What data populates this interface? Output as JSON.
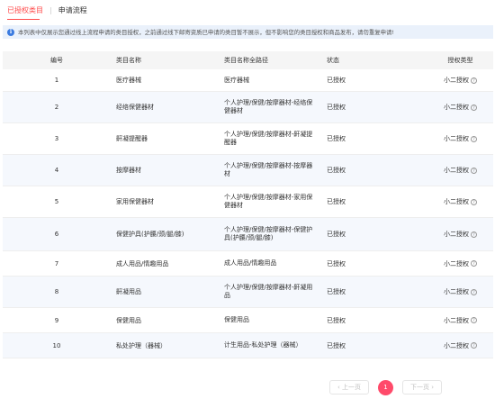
{
  "tabs": {
    "active": "已授权类目",
    "separator": "|",
    "inactive": "申请流程"
  },
  "notice": {
    "icon": "info-icon",
    "text": "本列表中仅展示您通过线上流程申请的类目授权，之前通过线下邮寄资质已申请的类目暂不展示，但不影响您的类目授权和商品发布，请勿重复申请!"
  },
  "table": {
    "headers": {
      "id": "编号",
      "name": "类目名称",
      "path": "类目名称全路径",
      "status": "状态",
      "type": "授权类型"
    },
    "rows": [
      {
        "id": "1",
        "name": "医疗器械",
        "path": "医疗器械",
        "status": "已授权",
        "type": "小二授权"
      },
      {
        "id": "2",
        "name": "经络保健器材",
        "path": "个人护理/保健/按摩器材-经络保健器材",
        "status": "已授权",
        "type": "小二授权"
      },
      {
        "id": "3",
        "name": "鼾凝提醒器",
        "path": "个人护理/保健/按摩器材-鼾凝提醒器",
        "status": "已授权",
        "type": "小二授权"
      },
      {
        "id": "4",
        "name": "按摩器材",
        "path": "个人护理/保健/按摩器材-按摩器材",
        "status": "已授权",
        "type": "小二授权"
      },
      {
        "id": "5",
        "name": "家用保健器材",
        "path": "个人护理/保健/按摩器材-家用保健器材",
        "status": "已授权",
        "type": "小二授权"
      },
      {
        "id": "6",
        "name": "保健护具(护腰/颈/腿/膝)",
        "path": "个人护理/保健/按摩器材-保健护具(护腰/颈/腿/膝)",
        "status": "已授权",
        "type": "小二授权"
      },
      {
        "id": "7",
        "name": "成人用品/情趣用品",
        "path": "成人用品/情趣用品",
        "status": "已授权",
        "type": "小二授权"
      },
      {
        "id": "8",
        "name": "鼾凝用品",
        "path": "个人护理/保健/按摩器材-鼾凝用品",
        "status": "已授权",
        "type": "小二授权"
      },
      {
        "id": "9",
        "name": "保健用品",
        "path": "保健用品",
        "status": "已授权",
        "type": "小二授权"
      },
      {
        "id": "10",
        "name": "私处护理（器械）",
        "path": "计生用品-私处护理（器械）",
        "status": "已授权",
        "type": "小二授权"
      }
    ],
    "help_icon": "?"
  },
  "pagination": {
    "prev": "‹ 上一页",
    "current": "1",
    "next": "下一页 ›"
  },
  "colors": {
    "accent": "#ff4a4a",
    "page_badge": "#ff4a6a",
    "notice_bg": "#eaf1fb",
    "info_icon": "#3b7be0"
  }
}
